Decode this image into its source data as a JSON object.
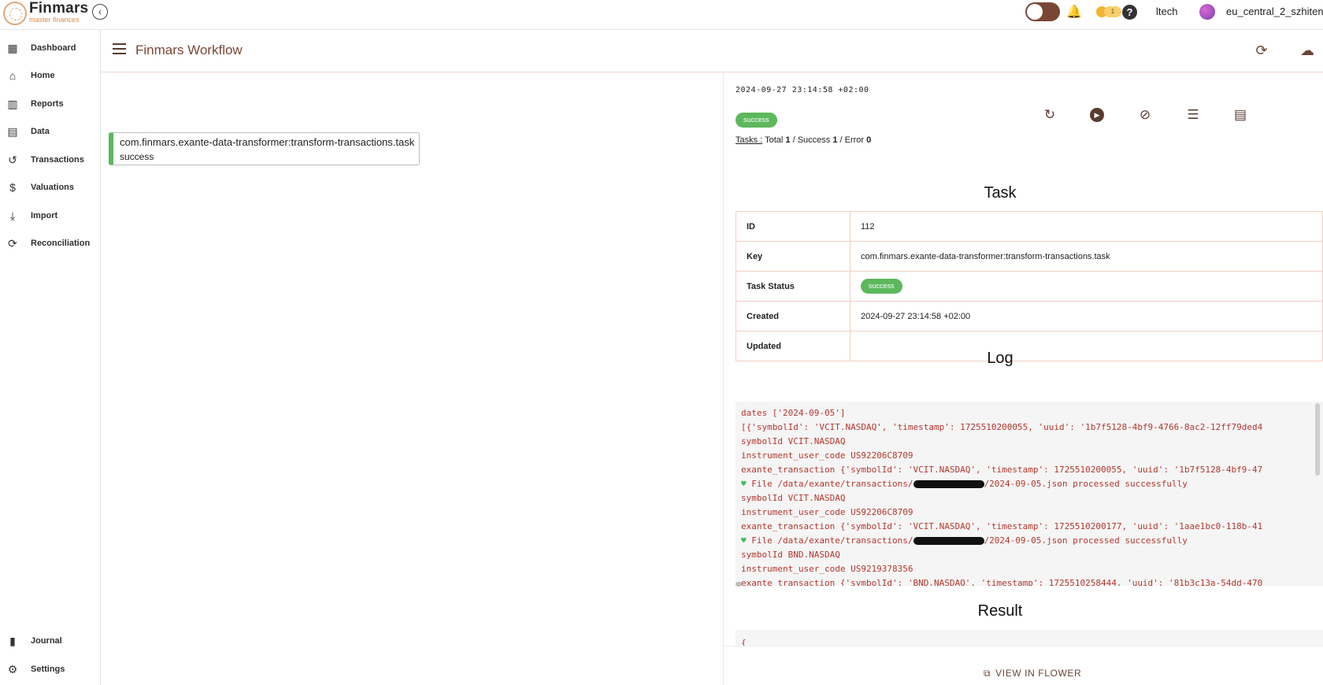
{
  "brand": {
    "name": "Finmars",
    "tagline": "master finances"
  },
  "topbar": {
    "user": "ltech",
    "workspace": "eu_central_2_szhitene",
    "notif_count": "1"
  },
  "sidebar": {
    "items": [
      {
        "label": "Dashboard",
        "icon": "dashboard-icon"
      },
      {
        "label": "Home",
        "icon": "home-icon"
      },
      {
        "label": "Reports",
        "icon": "reports-icon"
      },
      {
        "label": "Data",
        "icon": "data-icon"
      },
      {
        "label": "Transactions",
        "icon": "history-icon"
      },
      {
        "label": "Valuations",
        "icon": "valuation-icon"
      },
      {
        "label": "Import",
        "icon": "import-icon"
      },
      {
        "label": "Reconciliation",
        "icon": "reconcile-icon"
      }
    ],
    "bottom": [
      {
        "label": "Journal",
        "icon": "journal-icon"
      },
      {
        "label": "Settings",
        "icon": "gear-icon"
      }
    ]
  },
  "header": {
    "title": "Finmars Workflow"
  },
  "node": {
    "key": "com.finmars.exante-data-transformer:transform-transactions.task",
    "status": "success"
  },
  "detail": {
    "timestamp": "2024-09-27 23:14:58 +02:00",
    "status": "success",
    "tasks_label": "Tasks :",
    "total_label": "Total",
    "total": "1",
    "success_label": "/ Success",
    "success": "1",
    "error_label": "/ Error",
    "error": "0"
  },
  "task": {
    "title": "Task",
    "rows": [
      {
        "key": "ID",
        "value": "112"
      },
      {
        "key": "Key",
        "value": "com.finmars.exante-data-transformer:transform-transactions.task"
      },
      {
        "key": "Task Status",
        "value": "success"
      },
      {
        "key": "Created",
        "value": "2024-09-27 23:14:58 +02:00"
      },
      {
        "key": "Updated",
        "value": ""
      }
    ]
  },
  "log": {
    "title": "Log",
    "lines": [
      "dates ['2024-09-05']",
      "[{'symbolId': 'VCIT.NASDAQ', 'timestamp': 1725510200055, 'uuid': '1b7f5128-4bf9-4766-8ac2-12ff79ded4",
      "symbolId VCIT.NASDAQ",
      "instrument_user_code US92206C8709",
      "exante_transaction {'symbolId': 'VCIT.NASDAQ', 'timestamp': 1725510200055, 'uuid': '1b7f5128-4bf9-47",
      "symbolId VCIT.NASDAQ",
      "instrument_user_code US92206C8709",
      "exante_transaction {'symbolId': 'VCIT.NASDAQ', 'timestamp': 1725510200177, 'uuid': '1aae1bc0-118b-41",
      "symbolId BND.NASDAQ",
      "instrument_user_code US9219378356",
      "exante_transaction {'symbolId': 'BND.NASDAQ', 'timestamp': 1725510258444, 'uuid': '81b3c13a-54dd-470"
    ],
    "processed_prefix": "File /data/exante/transactions/",
    "processed_suffix": "/2024-09-05.json processed successfully"
  },
  "result": {
    "title": "Result",
    "text": "{"
  },
  "footer": {
    "flower_label": "VIEW IN FLOWER"
  },
  "colors": {
    "accent": "#7a4634",
    "success": "#5cb85c",
    "log_text": "#b4372c"
  }
}
